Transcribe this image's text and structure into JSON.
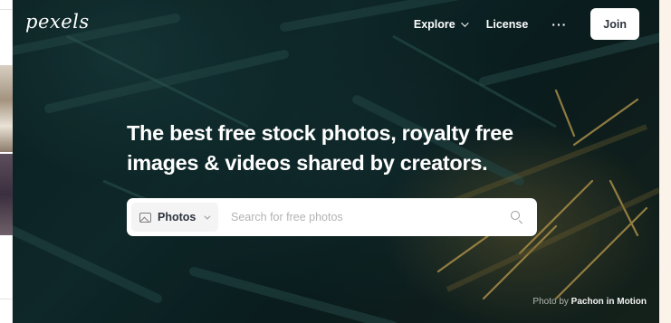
{
  "brand": {
    "logo_text": "pexels"
  },
  "nav": {
    "explore_label": "Explore",
    "license_label": "License",
    "more_label": "···",
    "join_label": "Join"
  },
  "hero": {
    "headline_line1": "The best free stock photos, royalty free",
    "headline_line2": "images & videos shared by creators."
  },
  "search": {
    "type_label": "Photos",
    "placeholder": "Search for free photos",
    "value": ""
  },
  "credit": {
    "prefix": "Photo by",
    "author": "Pachon in Motion"
  },
  "colors": {
    "hero_dark": "#0f2a2c",
    "accent_gold": "#c9a94a",
    "join_bg": "#ffffff",
    "text_dark": "#2c343e"
  },
  "icons": {
    "search": "search-icon",
    "image": "image-icon",
    "chevron": "chevron-down-icon",
    "more": "more-icon"
  }
}
